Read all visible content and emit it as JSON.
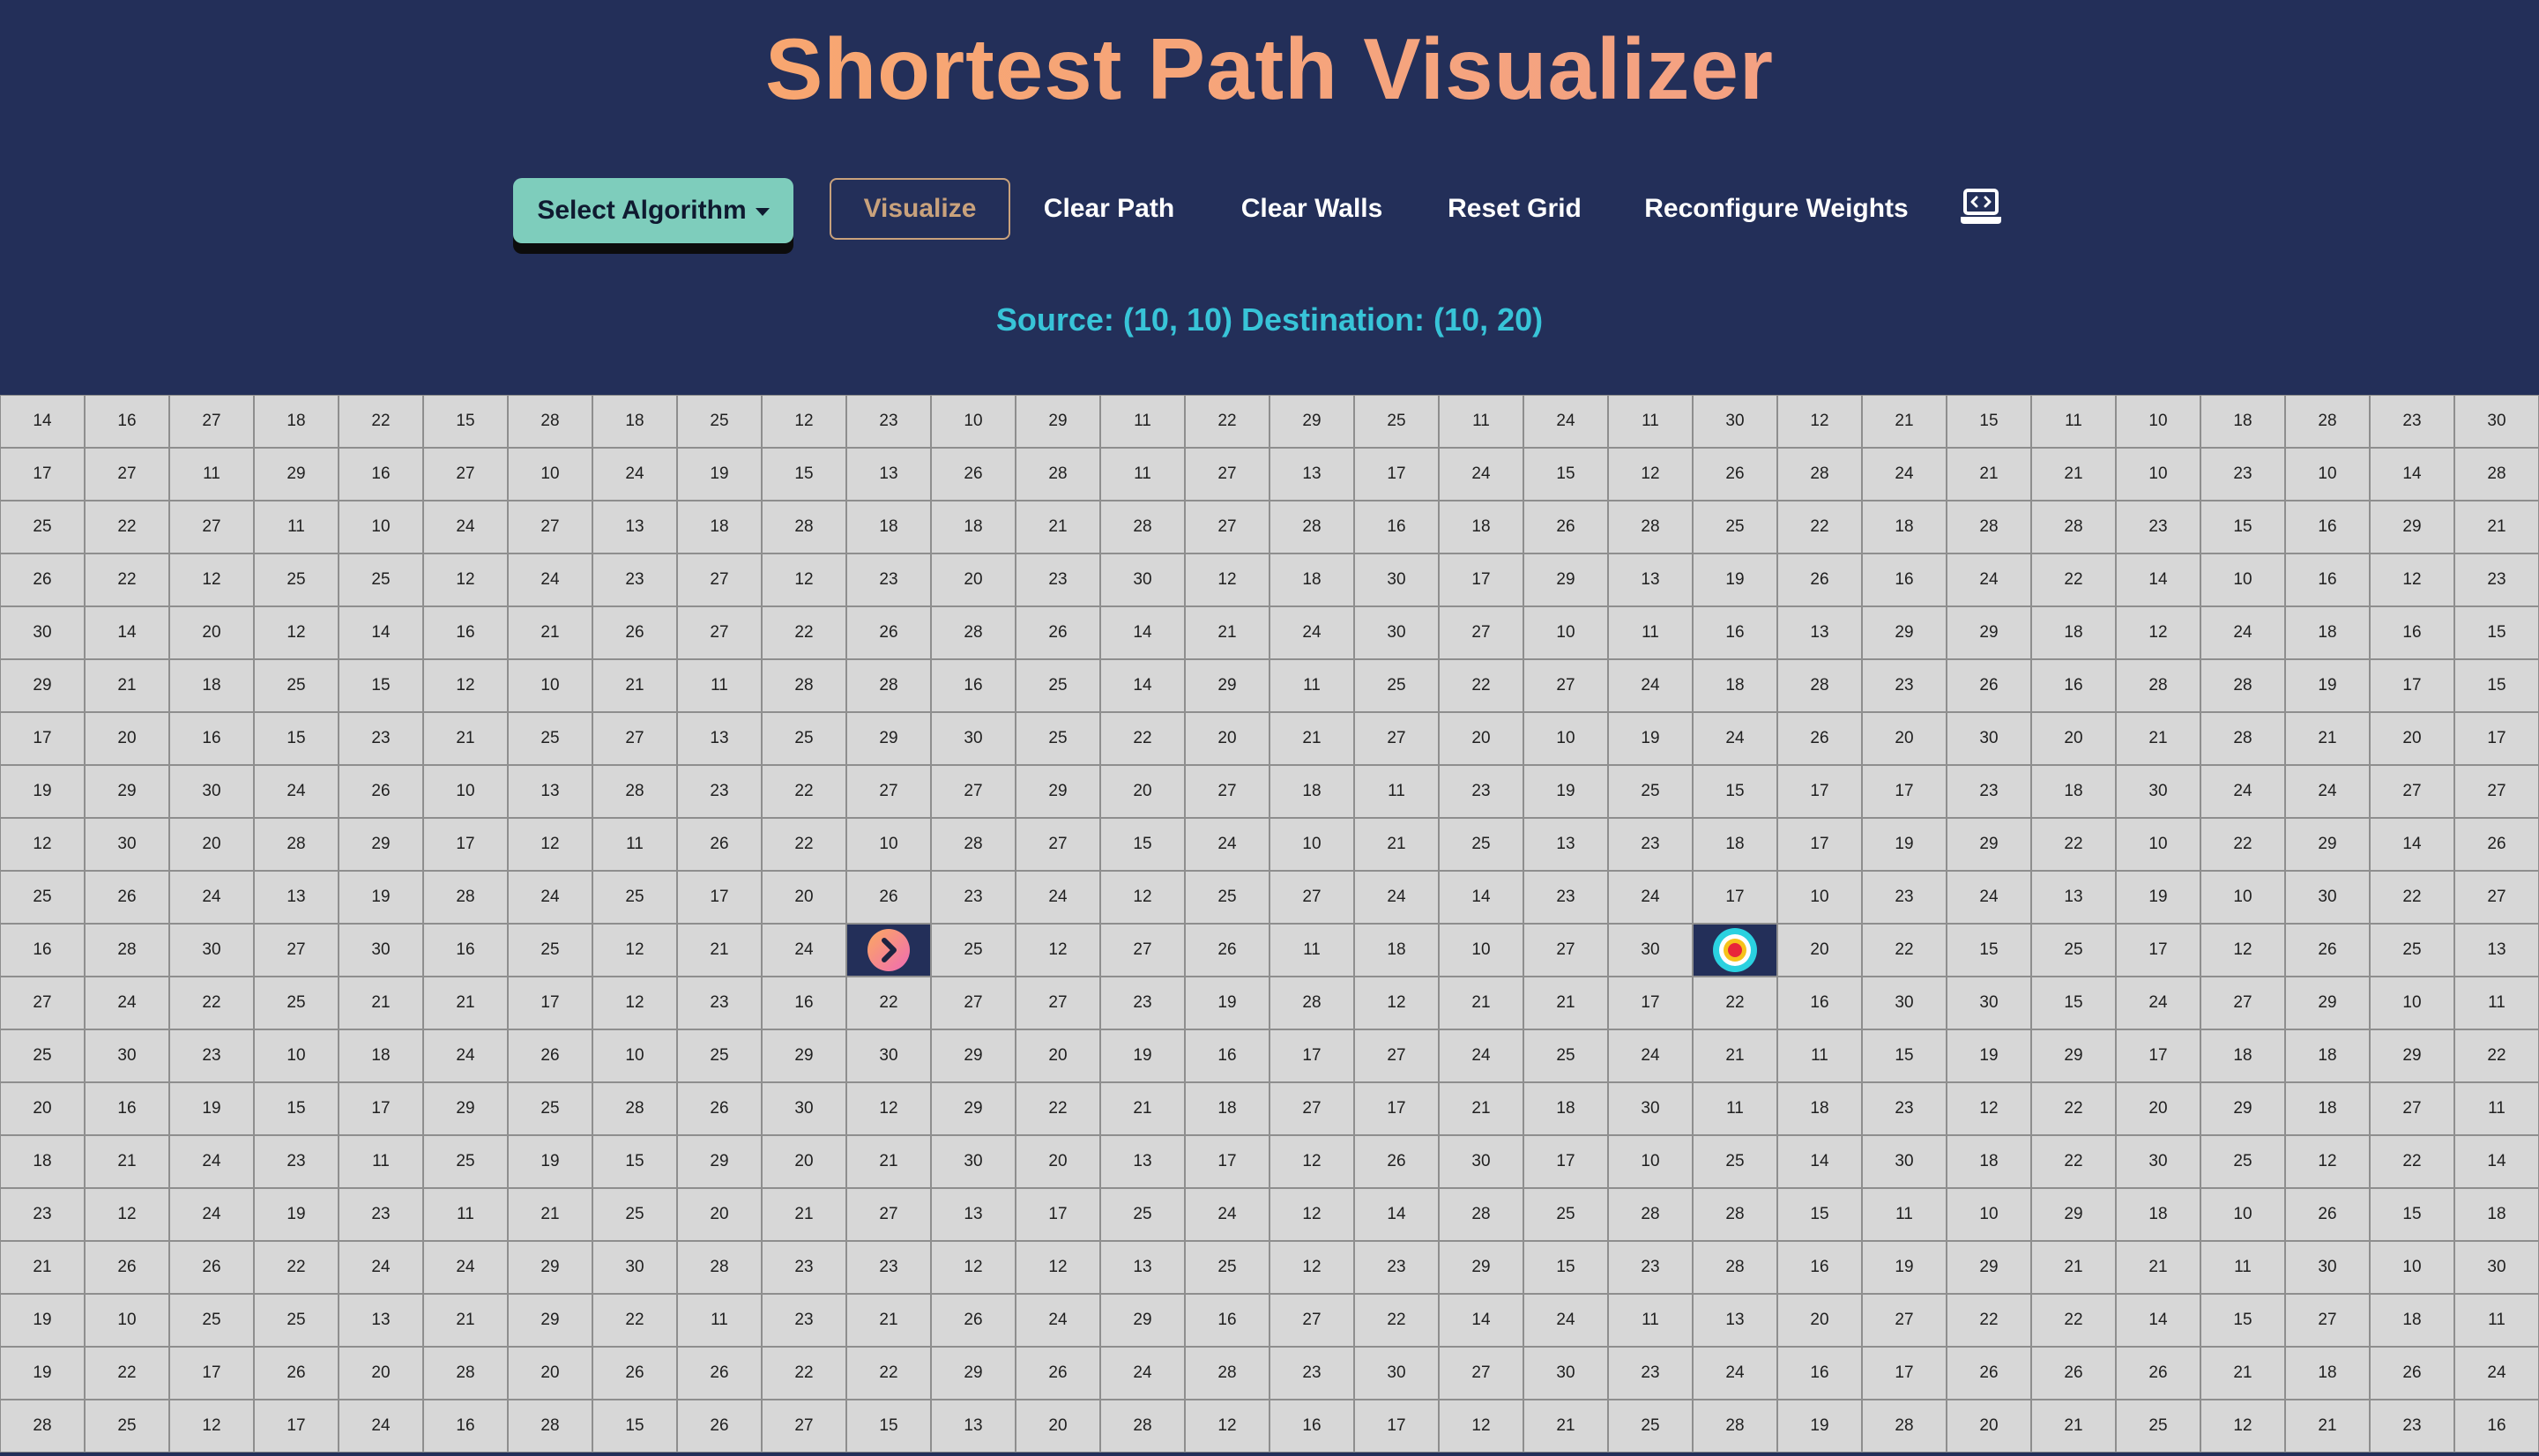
{
  "title": "Shortest Path Visualizer",
  "toolbar": {
    "select_algorithm": "Select Algorithm",
    "visualize": "Visualize",
    "clear_path": "Clear Path",
    "clear_walls": "Clear Walls",
    "reset_grid": "Reset Grid",
    "reconfigure_weights": "Reconfigure Weights",
    "code_icon": "laptop-code-icon"
  },
  "status": {
    "source_label": "Source:",
    "source": "(10, 10)",
    "destination_label": "Destination:",
    "destination": "(10, 20)"
  },
  "colors": {
    "background": "#232f59",
    "accent_teal": "#7ecdbc",
    "status_cyan": "#38c4d8",
    "title_orange": "#fba95f",
    "cell_gray": "#d7d7d7"
  },
  "grid": {
    "rows": 20,
    "cols": 30,
    "source": [
      10,
      10
    ],
    "destination": [
      10,
      20
    ],
    "source_icon": "chevron-right-circle-icon",
    "destination_icon": "target-icon",
    "weights": [
      [
        14,
        16,
        27,
        18,
        22,
        15,
        28,
        18,
        25,
        12,
        23,
        10,
        29,
        11,
        22,
        29,
        25,
        11,
        24,
        11,
        30,
        12,
        21,
        15,
        11,
        10,
        18,
        28,
        23,
        30
      ],
      [
        17,
        27,
        11,
        29,
        16,
        27,
        10,
        24,
        19,
        15,
        13,
        26,
        28,
        11,
        27,
        13,
        17,
        24,
        15,
        12,
        26,
        28,
        24,
        21,
        21,
        10,
        23,
        10,
        14,
        28
      ],
      [
        25,
        22,
        27,
        11,
        10,
        24,
        27,
        13,
        18,
        28,
        18,
        18,
        21,
        28,
        27,
        28,
        16,
        18,
        26,
        28,
        25,
        22,
        18,
        28,
        28,
        23,
        15,
        16,
        29,
        21
      ],
      [
        26,
        22,
        12,
        25,
        25,
        12,
        24,
        23,
        27,
        12,
        23,
        20,
        23,
        30,
        12,
        18,
        30,
        17,
        29,
        13,
        19,
        26,
        16,
        24,
        22,
        14,
        10,
        16,
        12,
        23
      ],
      [
        30,
        14,
        20,
        12,
        14,
        16,
        21,
        26,
        27,
        22,
        26,
        28,
        26,
        14,
        21,
        24,
        30,
        27,
        10,
        11,
        16,
        13,
        29,
        29,
        18,
        12,
        24,
        18,
        16,
        15
      ],
      [
        29,
        21,
        18,
        25,
        15,
        12,
        10,
        21,
        11,
        28,
        28,
        16,
        25,
        14,
        29,
        11,
        25,
        22,
        27,
        24,
        18,
        28,
        23,
        26,
        16,
        28,
        28,
        19,
        17,
        15
      ],
      [
        17,
        20,
        16,
        15,
        23,
        21,
        25,
        27,
        13,
        25,
        29,
        30,
        25,
        22,
        20,
        21,
        27,
        20,
        10,
        19,
        24,
        26,
        20,
        30,
        20,
        21,
        28,
        21,
        20,
        17
      ],
      [
        19,
        29,
        30,
        24,
        26,
        10,
        13,
        28,
        23,
        22,
        27,
        27,
        29,
        20,
        27,
        18,
        11,
        23,
        19,
        25,
        15,
        17,
        17,
        23,
        18,
        30,
        24,
        24,
        27,
        27
      ],
      [
        12,
        30,
        20,
        28,
        29,
        17,
        12,
        11,
        26,
        22,
        10,
        28,
        27,
        15,
        24,
        10,
        21,
        25,
        13,
        23,
        18,
        17,
        19,
        29,
        22,
        10,
        22,
        29,
        14,
        26
      ],
      [
        25,
        26,
        24,
        13,
        19,
        28,
        24,
        25,
        17,
        20,
        26,
        23,
        24,
        12,
        25,
        27,
        24,
        14,
        23,
        24,
        17,
        10,
        23,
        24,
        13,
        19,
        10,
        30,
        22,
        27
      ],
      [
        16,
        28,
        30,
        27,
        30,
        16,
        25,
        12,
        21,
        24,
        null,
        25,
        12,
        27,
        26,
        11,
        18,
        10,
        27,
        30,
        null,
        20,
        22,
        15,
        25,
        17,
        12,
        26,
        25,
        13
      ],
      [
        27,
        24,
        22,
        25,
        21,
        21,
        17,
        12,
        23,
        16,
        22,
        27,
        27,
        23,
        19,
        28,
        12,
        21,
        21,
        17,
        22,
        16,
        30,
        30,
        15,
        24,
        27,
        29,
        10,
        11
      ],
      [
        25,
        30,
        23,
        10,
        18,
        24,
        26,
        10,
        25,
        29,
        30,
        29,
        20,
        19,
        16,
        17,
        27,
        24,
        25,
        24,
        21,
        11,
        15,
        19,
        29,
        17,
        18,
        18,
        29,
        22
      ],
      [
        20,
        16,
        19,
        15,
        17,
        29,
        25,
        28,
        26,
        30,
        12,
        29,
        22,
        21,
        18,
        27,
        17,
        21,
        18,
        30,
        11,
        18,
        23,
        12,
        22,
        20,
        29,
        18,
        27,
        11
      ],
      [
        18,
        21,
        24,
        23,
        11,
        25,
        19,
        15,
        29,
        20,
        21,
        30,
        20,
        13,
        17,
        12,
        26,
        30,
        17,
        10,
        25,
        14,
        30,
        18,
        22,
        30,
        25,
        12,
        22,
        14
      ],
      [
        23,
        12,
        24,
        19,
        23,
        11,
        21,
        25,
        20,
        21,
        27,
        13,
        17,
        25,
        24,
        12,
        14,
        28,
        25,
        28,
        28,
        15,
        11,
        10,
        29,
        18,
        10,
        26,
        15,
        18
      ],
      [
        21,
        26,
        26,
        22,
        24,
        24,
        29,
        30,
        28,
        23,
        23,
        12,
        12,
        13,
        25,
        12,
        23,
        29,
        15,
        23,
        28,
        16,
        19,
        29,
        21,
        21,
        11,
        30,
        10,
        30
      ],
      [
        19,
        10,
        25,
        25,
        13,
        21,
        29,
        22,
        11,
        23,
        21,
        26,
        24,
        29,
        16,
        27,
        22,
        14,
        24,
        11,
        13,
        20,
        27,
        22,
        22,
        14,
        15,
        27,
        18,
        11
      ],
      [
        19,
        22,
        17,
        26,
        20,
        28,
        20,
        26,
        26,
        22,
        22,
        29,
        26,
        24,
        28,
        23,
        30,
        27,
        30,
        23,
        24,
        16,
        17,
        26,
        26,
        26,
        21,
        18,
        26,
        24
      ],
      [
        28,
        25,
        12,
        17,
        24,
        16,
        28,
        15,
        26,
        27,
        15,
        13,
        20,
        28,
        12,
        16,
        17,
        12,
        21,
        25,
        28,
        19,
        28,
        20,
        21,
        25,
        12,
        21,
        23,
        16
      ]
    ]
  }
}
